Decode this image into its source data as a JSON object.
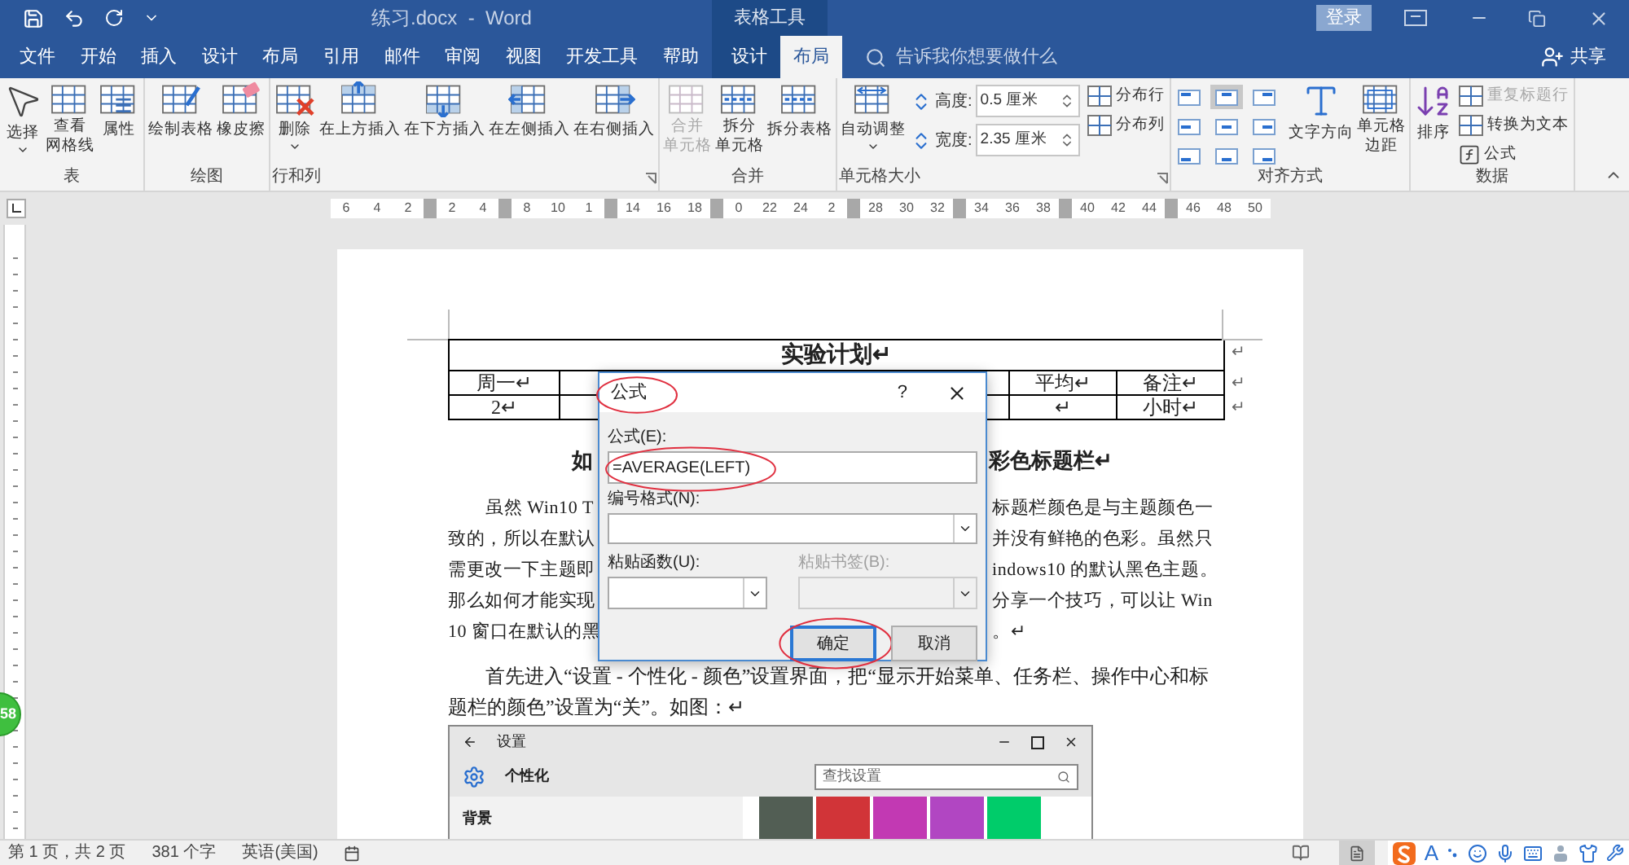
{
  "title_bar": {
    "document_title": "练习.docx  -  Word",
    "context_label": "表格工具",
    "sign_in": "登录"
  },
  "tabs": [
    {
      "label": "文件",
      "selected": false,
      "context": false
    },
    {
      "label": "开始",
      "selected": false,
      "context": false
    },
    {
      "label": "插入",
      "selected": false,
      "context": false
    },
    {
      "label": "设计",
      "selected": false,
      "context": false
    },
    {
      "label": "布局",
      "selected": false,
      "context": false
    },
    {
      "label": "引用",
      "selected": false,
      "context": false
    },
    {
      "label": "邮件",
      "selected": false,
      "context": false
    },
    {
      "label": "审阅",
      "selected": false,
      "context": false
    },
    {
      "label": "视图",
      "selected": false,
      "context": false
    },
    {
      "label": "开发工具",
      "selected": false,
      "context": false
    },
    {
      "label": "帮助",
      "selected": false,
      "context": false
    },
    {
      "label": "设计",
      "selected": false,
      "context": true
    },
    {
      "label": "布局",
      "selected": true,
      "context": true
    }
  ],
  "tell_me": {
    "placeholder": "告诉我你想要做什么"
  },
  "share": "共享",
  "ribbon_groups": [
    {
      "label": "表",
      "items": [
        {
          "kind": "large",
          "label": "选择",
          "dropdown": true,
          "disabled": false
        },
        {
          "kind": "large",
          "label_lines": [
            "查看",
            "网格线"
          ],
          "dropdown": false,
          "disabled": false
        },
        {
          "kind": "large",
          "label": "属性",
          "dropdown": false,
          "disabled": false
        }
      ]
    },
    {
      "label": "绘图",
      "items": [
        {
          "kind": "large",
          "label": "绘制表格",
          "dropdown": false,
          "disabled": false
        },
        {
          "kind": "large",
          "label": "橡皮擦",
          "dropdown": false,
          "disabled": false
        }
      ]
    },
    {
      "label": "行和列",
      "launcher": true,
      "items": [
        {
          "kind": "large",
          "label": "删除",
          "dropdown": true,
          "disabled": false
        },
        {
          "kind": "large",
          "label": "在上方插入",
          "dropdown": false,
          "disabled": false
        },
        {
          "kind": "large",
          "label": "在下方插入",
          "dropdown": false,
          "disabled": false
        },
        {
          "kind": "large",
          "label": "在左侧插入",
          "dropdown": false,
          "disabled": false
        },
        {
          "kind": "large",
          "label": "在右侧插入",
          "dropdown": false,
          "disabled": false
        }
      ]
    },
    {
      "label": "合并",
      "items": [
        {
          "kind": "large",
          "label_lines": [
            "合并",
            "单元格"
          ],
          "dropdown": false,
          "disabled": true
        },
        {
          "kind": "large",
          "label_lines": [
            "拆分",
            "单元格"
          ],
          "dropdown": false,
          "disabled": false
        },
        {
          "kind": "large",
          "label": "拆分表格",
          "dropdown": false,
          "disabled": false
        }
      ]
    },
    {
      "label": "单元格大小",
      "launcher": true,
      "items": [
        {
          "kind": "large",
          "label": "自动调整",
          "dropdown": true,
          "disabled": false
        },
        {
          "kind": "stack",
          "items": [
            {
              "kind": "field",
              "label": "高度:",
              "value": "0.5 厘米"
            },
            {
              "kind": "field",
              "label": "宽度:",
              "value": "2.35 厘米"
            }
          ]
        },
        {
          "kind": "stack",
          "items": [
            {
              "kind": "small",
              "label": "分布行",
              "disabled": false
            },
            {
              "kind": "small",
              "label": "分布列",
              "disabled": false
            }
          ]
        }
      ]
    },
    {
      "label": "对齐方式",
      "items": [
        {
          "kind": "align_grid",
          "cells": [
            {
              "selected": false
            },
            {
              "selected": true
            },
            {
              "selected": false
            },
            {
              "selected": false
            },
            {
              "selected": false
            },
            {
              "selected": false
            },
            {
              "selected": false
            },
            {
              "selected": false
            },
            {
              "selected": false
            }
          ]
        },
        {
          "kind": "large",
          "label": "文字方向",
          "dropdown": false,
          "disabled": false
        },
        {
          "kind": "large",
          "label_lines": [
            "单元格",
            "边距"
          ],
          "dropdown": false,
          "disabled": false
        }
      ]
    },
    {
      "label": "数据",
      "items": [
        {
          "kind": "large",
          "label": "排序",
          "dropdown": false,
          "disabled": false
        },
        {
          "kind": "stack",
          "items": [
            {
              "kind": "small",
              "label": "重复标题行",
              "disabled": true
            },
            {
              "kind": "small",
              "label": "转换为文本",
              "disabled": false
            },
            {
              "kind": "small",
              "label": "公式",
              "disabled": false
            }
          ]
        }
      ]
    }
  ],
  "ruler": [
    {
      "kind": "tick",
      "label": "6"
    },
    {
      "kind": "tick",
      "label": "4"
    },
    {
      "kind": "tick",
      "label": "2"
    },
    {
      "kind": "marker"
    },
    {
      "kind": "tick",
      "label": "2"
    },
    {
      "kind": "tick",
      "label": "4"
    },
    {
      "kind": "marker"
    },
    {
      "kind": "tick",
      "label": "8"
    },
    {
      "kind": "tick",
      "label": "10"
    },
    {
      "kind": "tick",
      "label": "1"
    },
    {
      "kind": "marker"
    },
    {
      "kind": "tick",
      "label": "14"
    },
    {
      "kind": "tick",
      "label": "16"
    },
    {
      "kind": "tick",
      "label": "18"
    },
    {
      "kind": "marker"
    },
    {
      "kind": "tick",
      "label": "0"
    },
    {
      "kind": "tick",
      "label": "22"
    },
    {
      "kind": "tick",
      "label": "24"
    },
    {
      "kind": "tick",
      "label": "2"
    },
    {
      "kind": "marker"
    },
    {
      "kind": "tick",
      "label": "28"
    },
    {
      "kind": "tick",
      "label": "30"
    },
    {
      "kind": "tick",
      "label": "32"
    },
    {
      "kind": "marker"
    },
    {
      "kind": "tick",
      "label": "34"
    },
    {
      "kind": "tick",
      "label": "36"
    },
    {
      "kind": "tick",
      "label": "38"
    },
    {
      "kind": "marker"
    },
    {
      "kind": "tick",
      "label": "40"
    },
    {
      "kind": "tick",
      "label": "42"
    },
    {
      "kind": "tick",
      "label": "44"
    },
    {
      "kind": "marker"
    },
    {
      "kind": "tick",
      "label": "46"
    },
    {
      "kind": "tick",
      "label": "48"
    },
    {
      "kind": "tick",
      "label": "50"
    }
  ],
  "document": {
    "table": {
      "title": "实验计划↵",
      "title_end_mark": "↵",
      "rows": [
        {
          "cells": [
            "周一↵",
            null,
            null,
            null,
            null,
            "平均↵",
            "备注↵"
          ],
          "end_mark": "↵"
        },
        {
          "cells": [
            "2↵",
            null,
            null,
            null,
            null,
            "↵",
            "小时↵"
          ],
          "end_mark": "↵"
        }
      ]
    },
    "heading": {
      "left": "如",
      "right": "彩色标题栏↵"
    },
    "paragraph_1": [
      {
        "left": "虽然 Win10 T",
        "right": "标题栏颜色是与主题颜色一"
      },
      {
        "left": "致的，所以在默认",
        "right": "并没有鲜艳的色彩。虽然只"
      },
      {
        "left": "需更改一下主题即",
        "right": "indows10 的默认黑色主题。"
      },
      {
        "left": "那么如何才能实现",
        "right": "分享一个技巧，可以让 Win"
      },
      {
        "left": "10 窗口在默认的黑",
        "right": "。↵"
      }
    ],
    "paragraph_2": [
      "首先进入“设置 - 个性化 - 颜色”设置界面，把“显示开始菜单、任务栏、操作中心和标",
      "题栏的颜色”设置为“关”。如图：↵"
    ],
    "settings_window": {
      "title": "设置",
      "page": "个性化",
      "search_placeholder": "查找设置",
      "nav_item": "背景",
      "swatches": [
        {
          "color": "#525e54"
        },
        {
          "color": "#d13438"
        },
        {
          "color": "#c239b3"
        },
        {
          "color": "#b146c2"
        },
        {
          "color": "#00cc6a"
        }
      ]
    }
  },
  "dialog": {
    "title": "公式",
    "title_circled": true,
    "help": "?",
    "formula_label": "公式(E):",
    "formula_value": "=AVERAGE(LEFT)",
    "formula_circled": true,
    "number_format_label": "编号格式(N):",
    "paste_function_label": "粘贴函数(U):",
    "paste_bookmark": {
      "label": "粘贴书签(B):",
      "disabled": true
    },
    "buttons": [
      {
        "label": "确定",
        "default": true,
        "circled": true
      },
      {
        "label": "取消",
        "default": false,
        "circled": false
      }
    ]
  },
  "floating_ball": {
    "label": "58"
  },
  "status_bar": {
    "items": [
      "第 1 页，共 2 页",
      "381 个字",
      "英语(美国)"
    ],
    "ime_mode": "A"
  }
}
